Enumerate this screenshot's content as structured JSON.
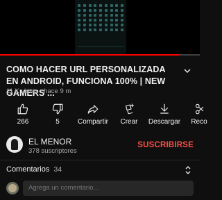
{
  "player": {
    "progress_fraction": 0.9
  },
  "video": {
    "title": "COMO HACER URL PERSONALIZADA EN ANDROID, FUNCIONA 100% | NEW GAMERS ...",
    "views": "11 K vistas",
    "separator": "·",
    "age": "hace 9 m"
  },
  "actions": [
    {
      "label": "266",
      "icon": "thumbs-up-icon"
    },
    {
      "label": "5",
      "icon": "thumbs-down-icon"
    },
    {
      "label": "Compartir",
      "icon": "share-icon"
    },
    {
      "label": "Crear",
      "icon": "create-icon"
    },
    {
      "label": "Descargar",
      "icon": "download-icon"
    },
    {
      "label": "Reco",
      "icon": "remix-icon"
    }
  ],
  "channel": {
    "name": "EL MENOR",
    "subscribers": "378 suscriptores",
    "subscribe_label": "SUSCRIBIRSE"
  },
  "comments": {
    "title": "Comentarios",
    "count": "34",
    "placeholder": "Agrega un comentario..."
  },
  "colors": {
    "background": "#0f0f0f",
    "progress": "#ff0000",
    "subscribe": "#ff4e45",
    "secondary_text": "#aaaaaa"
  }
}
